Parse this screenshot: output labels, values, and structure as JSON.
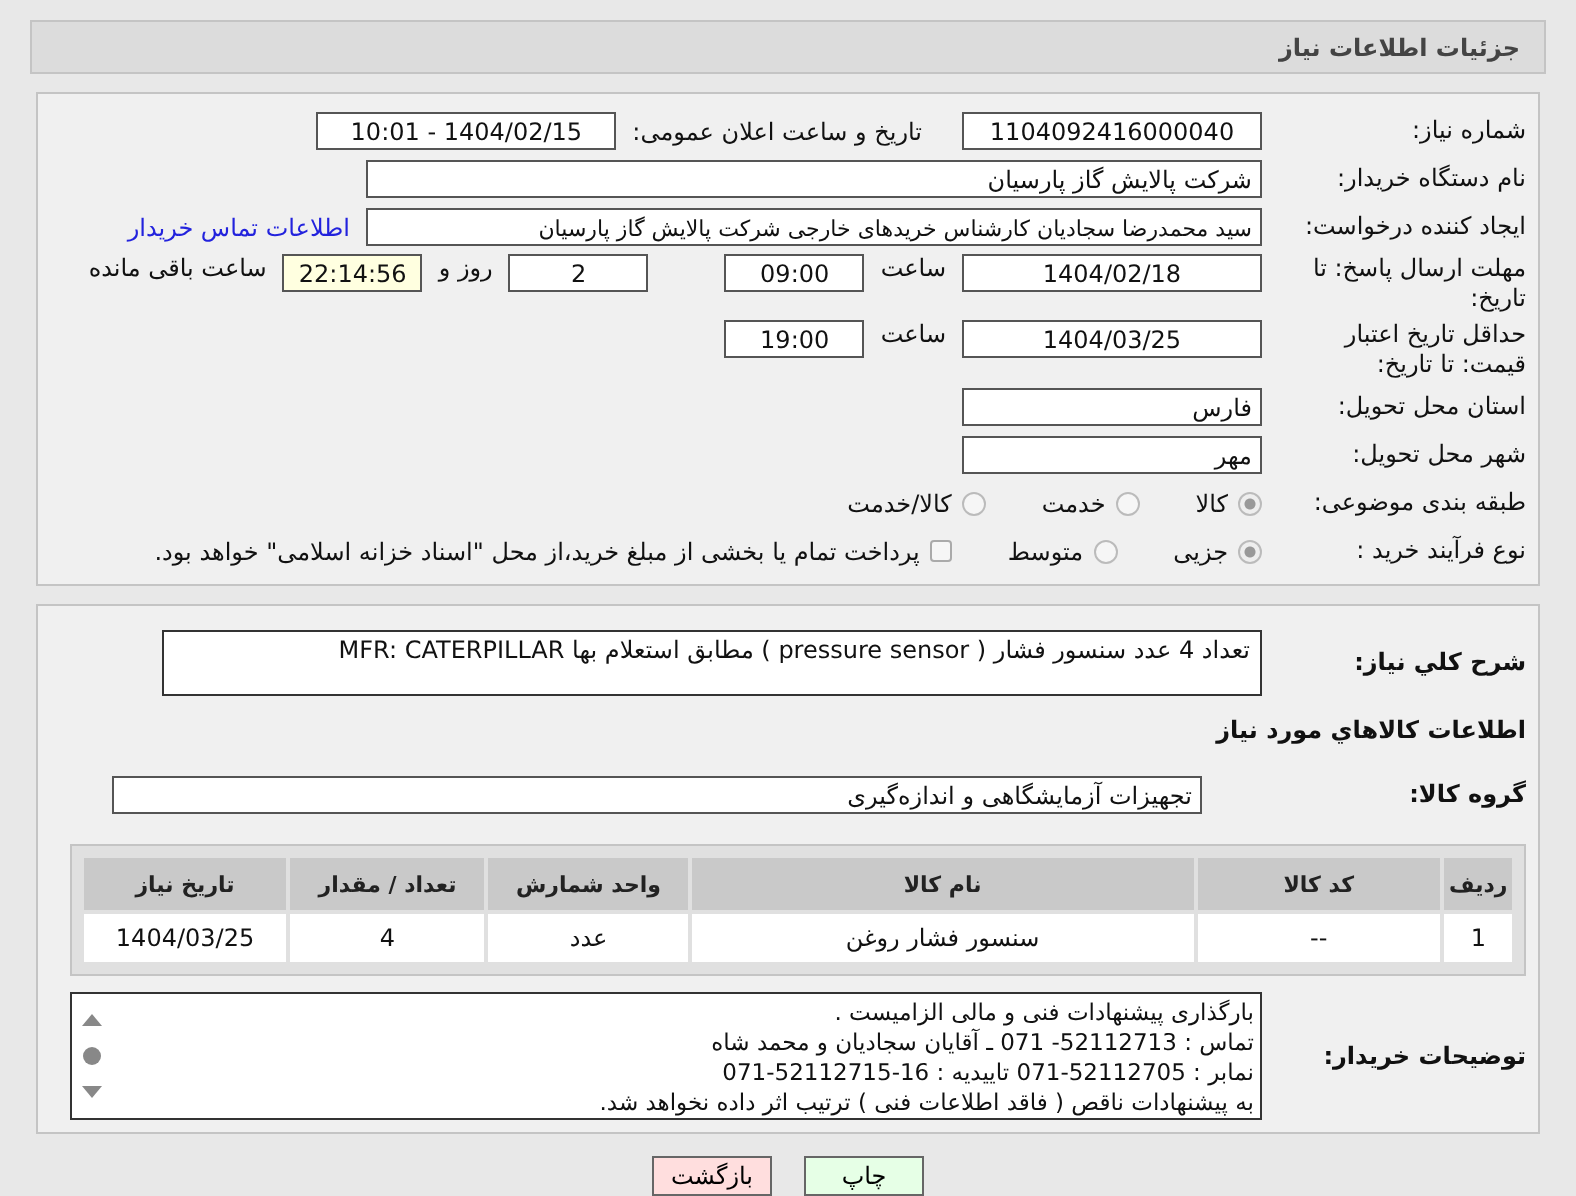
{
  "header": {
    "title": "جزئیات اطلاعات نیاز"
  },
  "need_number": {
    "label": "شماره نیاز:",
    "value": "1104092416000040"
  },
  "announce": {
    "label": "تاریخ و ساعت اعلان عمومی:",
    "value": "1404/02/15 - 10:01"
  },
  "buyer": {
    "label": "نام دستگاه خریدار:",
    "value": "شرکت پالایش گاز پارسیان"
  },
  "requester": {
    "label": "ایجاد کننده درخواست:",
    "value": "سید محمدرضا سجادیان کارشناس خریدهای خارجی شرکت پالایش گاز پارسیان",
    "link": "اطلاعات تماس خریدار"
  },
  "deadline": {
    "label": "مهلت ارسال پاسخ: تا تاریخ:",
    "date": "1404/02/18",
    "time_label": "ساعت",
    "time": "09:00",
    "days": "2",
    "days_label": "روز و",
    "remaining": "22:14:56",
    "remaining_label": "ساعت باقی مانده"
  },
  "validity": {
    "label": "حداقل تاریخ اعتبار قیمت: تا تاریخ:",
    "date": "1404/03/25",
    "time_label": "ساعت",
    "time": "19:00"
  },
  "province": {
    "label": "استان محل تحویل:",
    "value": "فارس"
  },
  "city": {
    "label": "شهر محل تحویل:",
    "value": "مهر"
  },
  "category": {
    "label": "طبقه بندی موضوعی:",
    "options": [
      {
        "label": "کالا",
        "selected": true
      },
      {
        "label": "خدمت",
        "selected": false
      },
      {
        "label": "کالا/خدمت",
        "selected": false
      }
    ]
  },
  "process": {
    "label": "نوع فرآیند خرید :",
    "options": [
      {
        "label": "جزیی",
        "selected": true
      },
      {
        "label": "متوسط",
        "selected": false
      }
    ],
    "payment": {
      "checked": false,
      "text": "پرداخت تمام یا بخشی از مبلغ خرید،از محل \"اسناد خزانه اسلامی\" خواهد بود."
    }
  },
  "description": {
    "label": "شرح کلي نیاز:",
    "value": "تعداد 4 عدد سنسور فشار ( pressure sensor ) مطابق استعلام بها   MFR: CATERPILLAR"
  },
  "goods_title": "اطلاعات کالاهاي مورد نیاز",
  "goods_group": {
    "label": "گروه کالا:",
    "value": "تجهیزات آزمایشگاهی و اندازه‌گیری"
  },
  "table": {
    "columns": [
      "ردیف",
      "کد کالا",
      "نام کالا",
      "واحد شمارش",
      "تعداد / مقدار",
      "تاریخ نیاز"
    ],
    "rows": [
      [
        "1",
        "--",
        "سنسور فشار روغن",
        "عدد",
        "4",
        "1404/03/25"
      ]
    ]
  },
  "notes": {
    "label": "توضیحات خریدار:",
    "lines": [
      "بارگذاری پیشنهادات فنی و مالی الزامیست .",
      "تماس : 52112713- 071 ـ آقایان سجادیان و محمد شاه",
      "نمابر : 52112705-071 تاییدیه : 16-52112715-071",
      "به پیشنهادات ناقص ( فاقد اطلاعات فنی ) ترتیب اثر داده نخواهد شد."
    ]
  },
  "buttons": [
    {
      "label": "چاپ",
      "kind": "print"
    },
    {
      "label": "بازگشت",
      "kind": "back"
    }
  ]
}
